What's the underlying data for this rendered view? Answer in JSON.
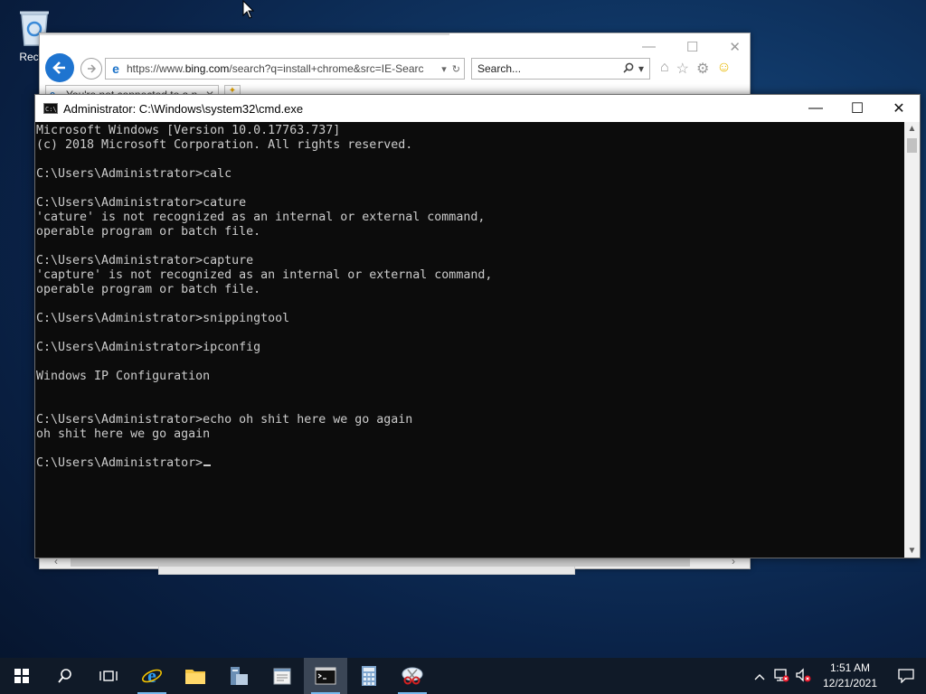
{
  "desktop": {
    "recycle_bin_label": "Recyc"
  },
  "ie": {
    "address_prefix": "https://www.",
    "address_host": "bing.com",
    "address_rest": "/search?q=install+chrome&src=IE-Searc",
    "search_placeholder": "Search...",
    "tab_title": "You're not connected to a n",
    "controls": {
      "minimize": "—",
      "maximize": "☐",
      "close": "✕"
    }
  },
  "cmd": {
    "title": "Administrator: C:\\Windows\\system32\\cmd.exe",
    "lines": [
      "Microsoft Windows [Version 10.0.17763.737]",
      "(c) 2018 Microsoft Corporation. All rights reserved.",
      "",
      "C:\\Users\\Administrator>calc",
      "",
      "C:\\Users\\Administrator>cature",
      "'cature' is not recognized as an internal or external command,",
      "operable program or batch file.",
      "",
      "C:\\Users\\Administrator>capture",
      "'capture' is not recognized as an internal or external command,",
      "operable program or batch file.",
      "",
      "C:\\Users\\Administrator>snippingtool",
      "",
      "C:\\Users\\Administrator>ipconfig",
      "",
      "Windows IP Configuration",
      "",
      "",
      "C:\\Users\\Administrator>echo oh shit here we go again",
      "oh shit here we go again",
      ""
    ],
    "prompt": "C:\\Users\\Administrator>",
    "controls": {
      "minimize": "—",
      "maximize": "☐",
      "close": "✕"
    }
  },
  "taskbar": {
    "icons": [
      "windows-start-icon",
      "search-icon",
      "task-view-icon",
      "internet-explorer-icon",
      "file-explorer-icon",
      "server-manager-icon",
      "notepad-icon",
      "cmd-icon",
      "calculator-icon",
      "snipping-tool-icon"
    ],
    "clock_time": "1:51 AM",
    "clock_date": "12/21/2021"
  }
}
